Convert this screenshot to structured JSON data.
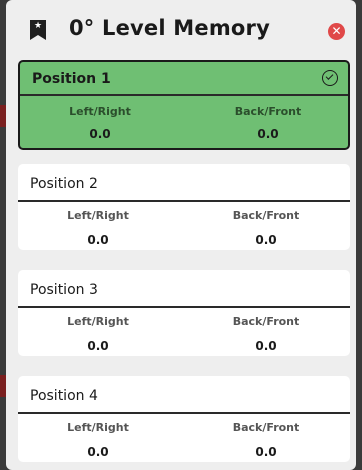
{
  "header": {
    "title": "0° Level Memory"
  },
  "icons": {
    "bookmark": "bookmark-icon",
    "close": "close-icon",
    "check": "check-circle-icon"
  },
  "colors": {
    "active": "#6fbf73",
    "close": "#e04848"
  },
  "positions": [
    {
      "title": "Position 1",
      "left_right_label": "Left/Right",
      "back_front_label": "Back/Front",
      "left_right_value": "0.0",
      "back_front_value": "0.0",
      "active": true
    },
    {
      "title": "Position 2",
      "left_right_label": "Left/Right",
      "back_front_label": "Back/Front",
      "left_right_value": "0.0",
      "back_front_value": "0.0",
      "active": false
    },
    {
      "title": "Position 3",
      "left_right_label": "Left/Right",
      "back_front_label": "Back/Front",
      "left_right_value": "0.0",
      "back_front_value": "0.0",
      "active": false
    },
    {
      "title": "Position 4",
      "left_right_label": "Left/Right",
      "back_front_label": "Back/Front",
      "left_right_value": "0.0",
      "back_front_value": "0.0",
      "active": false
    }
  ]
}
